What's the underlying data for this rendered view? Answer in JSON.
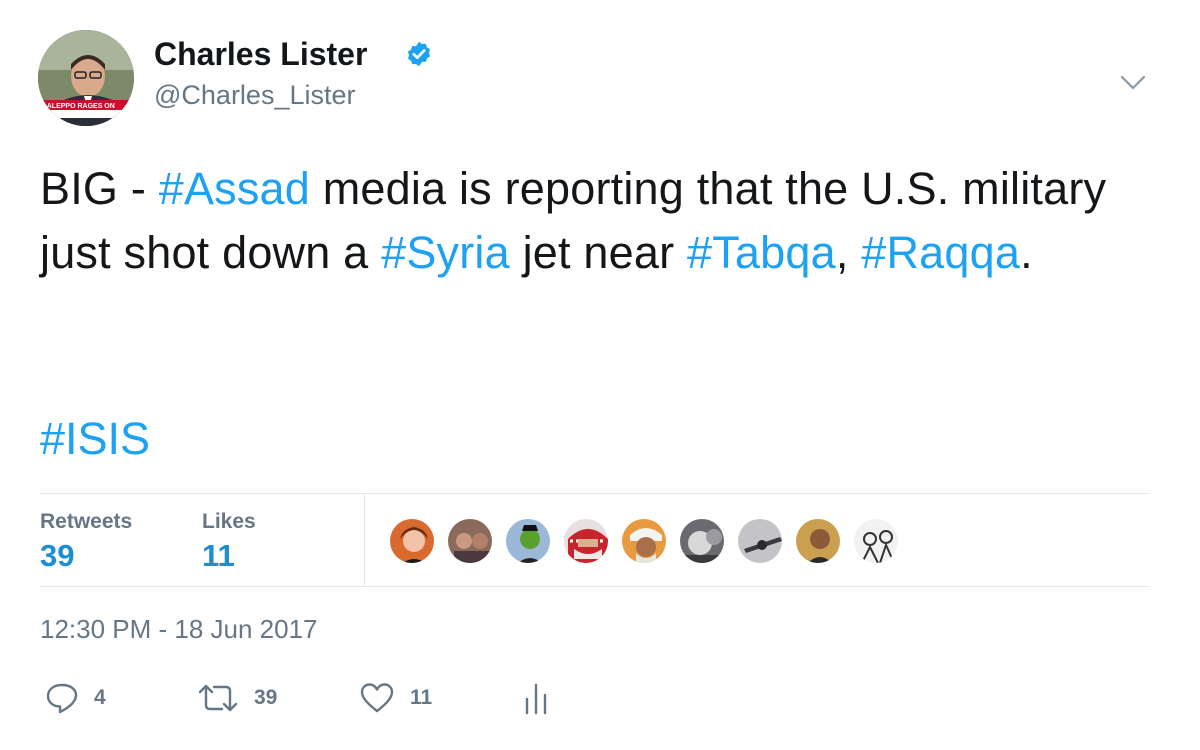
{
  "author": {
    "name": "Charles Lister",
    "handle": "@Charles_Lister",
    "verified": true,
    "avatar_caption": "R ALEPPO RAGES ON"
  },
  "tweet": {
    "segments": [
      {
        "text": "BIG - ",
        "hashtag": false
      },
      {
        "text": "#Assad",
        "hashtag": true
      },
      {
        "text": " media is reporting that the U.S. military just shot down a ",
        "hashtag": false
      },
      {
        "text": "#Syria",
        "hashtag": true
      },
      {
        "text": " jet near ",
        "hashtag": false
      },
      {
        "text": "#Tabqa",
        "hashtag": true
      },
      {
        "text": ", ",
        "hashtag": false
      },
      {
        "text": "#Raqqa",
        "hashtag": true
      },
      {
        "text": ".",
        "hashtag": false
      }
    ],
    "trailing_hashtag": "#ISIS"
  },
  "stats": {
    "retweets_label": "Retweets",
    "retweets_count": "39",
    "likes_label": "Likes",
    "likes_count": "11"
  },
  "timestamp": "12:30 PM - 18 Jun 2017",
  "actions": {
    "replies": "4",
    "retweets": "39",
    "likes": "11"
  },
  "colors": {
    "hashtag": "#1da1f2",
    "muted": "#657786",
    "stat_value": "#1d8ed6",
    "verified": "#1da1f2"
  },
  "icons": {
    "menu": "chevron-down-icon",
    "reply": "reply-icon",
    "retweet": "retweet-icon",
    "like": "heart-icon",
    "analytics": "analytics-icon"
  }
}
